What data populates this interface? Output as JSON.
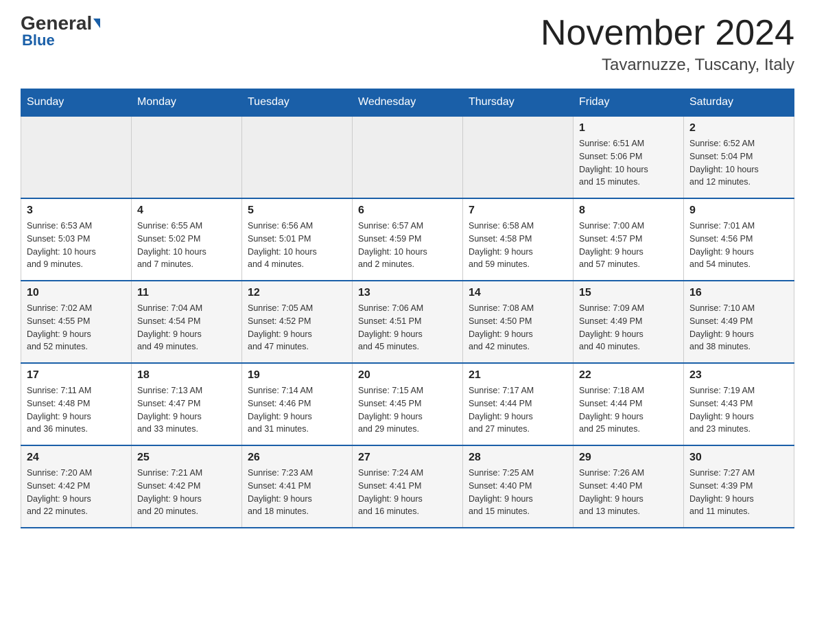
{
  "header": {
    "logo": {
      "general": "General",
      "blue": "Blue"
    },
    "title": "November 2024",
    "subtitle": "Tavarnuzze, Tuscany, Italy"
  },
  "days_of_week": [
    "Sunday",
    "Monday",
    "Tuesday",
    "Wednesday",
    "Thursday",
    "Friday",
    "Saturday"
  ],
  "weeks": [
    [
      {
        "day": "",
        "info": ""
      },
      {
        "day": "",
        "info": ""
      },
      {
        "day": "",
        "info": ""
      },
      {
        "day": "",
        "info": ""
      },
      {
        "day": "",
        "info": ""
      },
      {
        "day": "1",
        "info": "Sunrise: 6:51 AM\nSunset: 5:06 PM\nDaylight: 10 hours\nand 15 minutes."
      },
      {
        "day": "2",
        "info": "Sunrise: 6:52 AM\nSunset: 5:04 PM\nDaylight: 10 hours\nand 12 minutes."
      }
    ],
    [
      {
        "day": "3",
        "info": "Sunrise: 6:53 AM\nSunset: 5:03 PM\nDaylight: 10 hours\nand 9 minutes."
      },
      {
        "day": "4",
        "info": "Sunrise: 6:55 AM\nSunset: 5:02 PM\nDaylight: 10 hours\nand 7 minutes."
      },
      {
        "day": "5",
        "info": "Sunrise: 6:56 AM\nSunset: 5:01 PM\nDaylight: 10 hours\nand 4 minutes."
      },
      {
        "day": "6",
        "info": "Sunrise: 6:57 AM\nSunset: 4:59 PM\nDaylight: 10 hours\nand 2 minutes."
      },
      {
        "day": "7",
        "info": "Sunrise: 6:58 AM\nSunset: 4:58 PM\nDaylight: 9 hours\nand 59 minutes."
      },
      {
        "day": "8",
        "info": "Sunrise: 7:00 AM\nSunset: 4:57 PM\nDaylight: 9 hours\nand 57 minutes."
      },
      {
        "day": "9",
        "info": "Sunrise: 7:01 AM\nSunset: 4:56 PM\nDaylight: 9 hours\nand 54 minutes."
      }
    ],
    [
      {
        "day": "10",
        "info": "Sunrise: 7:02 AM\nSunset: 4:55 PM\nDaylight: 9 hours\nand 52 minutes."
      },
      {
        "day": "11",
        "info": "Sunrise: 7:04 AM\nSunset: 4:54 PM\nDaylight: 9 hours\nand 49 minutes."
      },
      {
        "day": "12",
        "info": "Sunrise: 7:05 AM\nSunset: 4:52 PM\nDaylight: 9 hours\nand 47 minutes."
      },
      {
        "day": "13",
        "info": "Sunrise: 7:06 AM\nSunset: 4:51 PM\nDaylight: 9 hours\nand 45 minutes."
      },
      {
        "day": "14",
        "info": "Sunrise: 7:08 AM\nSunset: 4:50 PM\nDaylight: 9 hours\nand 42 minutes."
      },
      {
        "day": "15",
        "info": "Sunrise: 7:09 AM\nSunset: 4:49 PM\nDaylight: 9 hours\nand 40 minutes."
      },
      {
        "day": "16",
        "info": "Sunrise: 7:10 AM\nSunset: 4:49 PM\nDaylight: 9 hours\nand 38 minutes."
      }
    ],
    [
      {
        "day": "17",
        "info": "Sunrise: 7:11 AM\nSunset: 4:48 PM\nDaylight: 9 hours\nand 36 minutes."
      },
      {
        "day": "18",
        "info": "Sunrise: 7:13 AM\nSunset: 4:47 PM\nDaylight: 9 hours\nand 33 minutes."
      },
      {
        "day": "19",
        "info": "Sunrise: 7:14 AM\nSunset: 4:46 PM\nDaylight: 9 hours\nand 31 minutes."
      },
      {
        "day": "20",
        "info": "Sunrise: 7:15 AM\nSunset: 4:45 PM\nDaylight: 9 hours\nand 29 minutes."
      },
      {
        "day": "21",
        "info": "Sunrise: 7:17 AM\nSunset: 4:44 PM\nDaylight: 9 hours\nand 27 minutes."
      },
      {
        "day": "22",
        "info": "Sunrise: 7:18 AM\nSunset: 4:44 PM\nDaylight: 9 hours\nand 25 minutes."
      },
      {
        "day": "23",
        "info": "Sunrise: 7:19 AM\nSunset: 4:43 PM\nDaylight: 9 hours\nand 23 minutes."
      }
    ],
    [
      {
        "day": "24",
        "info": "Sunrise: 7:20 AM\nSunset: 4:42 PM\nDaylight: 9 hours\nand 22 minutes."
      },
      {
        "day": "25",
        "info": "Sunrise: 7:21 AM\nSunset: 4:42 PM\nDaylight: 9 hours\nand 20 minutes."
      },
      {
        "day": "26",
        "info": "Sunrise: 7:23 AM\nSunset: 4:41 PM\nDaylight: 9 hours\nand 18 minutes."
      },
      {
        "day": "27",
        "info": "Sunrise: 7:24 AM\nSunset: 4:41 PM\nDaylight: 9 hours\nand 16 minutes."
      },
      {
        "day": "28",
        "info": "Sunrise: 7:25 AM\nSunset: 4:40 PM\nDaylight: 9 hours\nand 15 minutes."
      },
      {
        "day": "29",
        "info": "Sunrise: 7:26 AM\nSunset: 4:40 PM\nDaylight: 9 hours\nand 13 minutes."
      },
      {
        "day": "30",
        "info": "Sunrise: 7:27 AM\nSunset: 4:39 PM\nDaylight: 9 hours\nand 11 minutes."
      }
    ]
  ]
}
